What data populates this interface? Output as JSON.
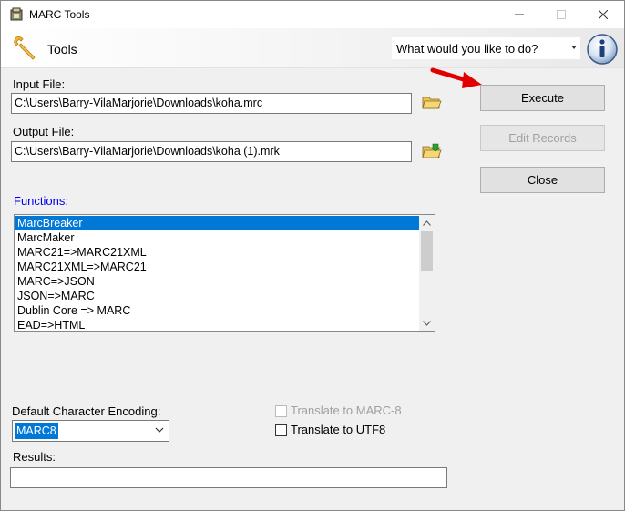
{
  "window": {
    "title": "MARC Tools"
  },
  "toolbar": {
    "tools_label": "Tools",
    "task_combo": "What would you like to do?"
  },
  "input": {
    "label": "Input File:",
    "value": "C:\\Users\\Barry-VilaMarjorie\\Downloads\\koha.mrc"
  },
  "output": {
    "label": "Output File:",
    "value": "C:\\Users\\Barry-VilaMarjorie\\Downloads\\koha (1).mrk"
  },
  "buttons": {
    "execute": "Execute",
    "edit_records": "Edit Records",
    "close": "Close"
  },
  "functions": {
    "label": "Functions:",
    "items": [
      {
        "label": "MarcBreaker",
        "selected": true
      },
      {
        "label": "MarcMaker",
        "selected": false
      },
      {
        "label": "MARC21=>MARC21XML",
        "selected": false
      },
      {
        "label": "MARC21XML=>MARC21",
        "selected": false
      },
      {
        "label": "MARC=>JSON",
        "selected": false
      },
      {
        "label": "JSON=>MARC",
        "selected": false
      },
      {
        "label": "Dublin Core => MARC",
        "selected": false
      },
      {
        "label": "EAD=>HTML",
        "selected": false
      }
    ]
  },
  "encoding": {
    "label": "Default Character Encoding:",
    "selected": "MARC8"
  },
  "options": {
    "translate_marc8": {
      "label": "Translate to MARC-8",
      "checked": false,
      "enabled": false
    },
    "translate_utf8": {
      "label": "Translate to UTF8",
      "checked": false,
      "enabled": true
    }
  },
  "results": {
    "label": "Results:",
    "value": ""
  },
  "colors": {
    "selection": "#0078d7",
    "functions_label": "#0000ee",
    "arrow": "#e00000"
  }
}
